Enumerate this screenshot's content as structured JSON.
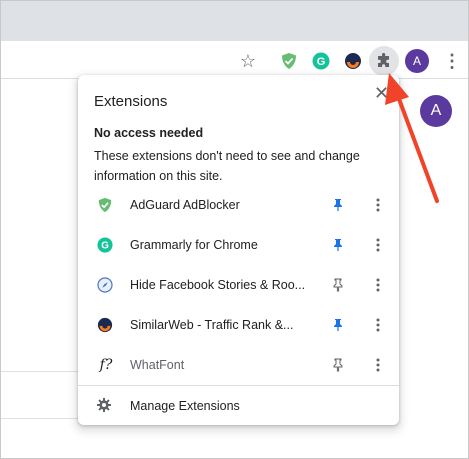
{
  "toolbar": {
    "avatar_initial": "A",
    "icons": [
      "star-icon",
      "adguard-icon",
      "grammarly-icon",
      "similarweb-icon",
      "extensions-puzzle-icon",
      "profile-avatar",
      "menu-icon"
    ]
  },
  "page": {
    "avatar_initial": "A"
  },
  "extensions_popup": {
    "title": "Extensions",
    "close_icon": "close-icon",
    "section_heading": "No access needed",
    "section_description": "These extensions don't need to see and change information on this site.",
    "items": [
      {
        "name": "AdGuard AdBlocker",
        "icon": "adguard-shield-icon",
        "pinned": true
      },
      {
        "name": "Grammarly for Chrome",
        "icon": "grammarly-icon",
        "pinned": true
      },
      {
        "name": "Hide Facebook Stories & Roo...",
        "icon": "compass-icon",
        "pinned": false
      },
      {
        "name": "SimilarWeb - Traffic Rank &...",
        "icon": "similarweb-icon",
        "pinned": true
      },
      {
        "name": "WhatFont",
        "icon": "whatfont-icon",
        "pinned": false,
        "muted": true,
        "icon_text": "f?"
      }
    ],
    "manage_label": "Manage Extensions"
  },
  "colors": {
    "pin_active": "#1a73e8",
    "pin_inactive": "#5f6368",
    "annotation_arrow": "#f0432a",
    "avatar": "#5a3a9e",
    "adguard": "#68bc71",
    "grammarly": "#15c39a"
  }
}
